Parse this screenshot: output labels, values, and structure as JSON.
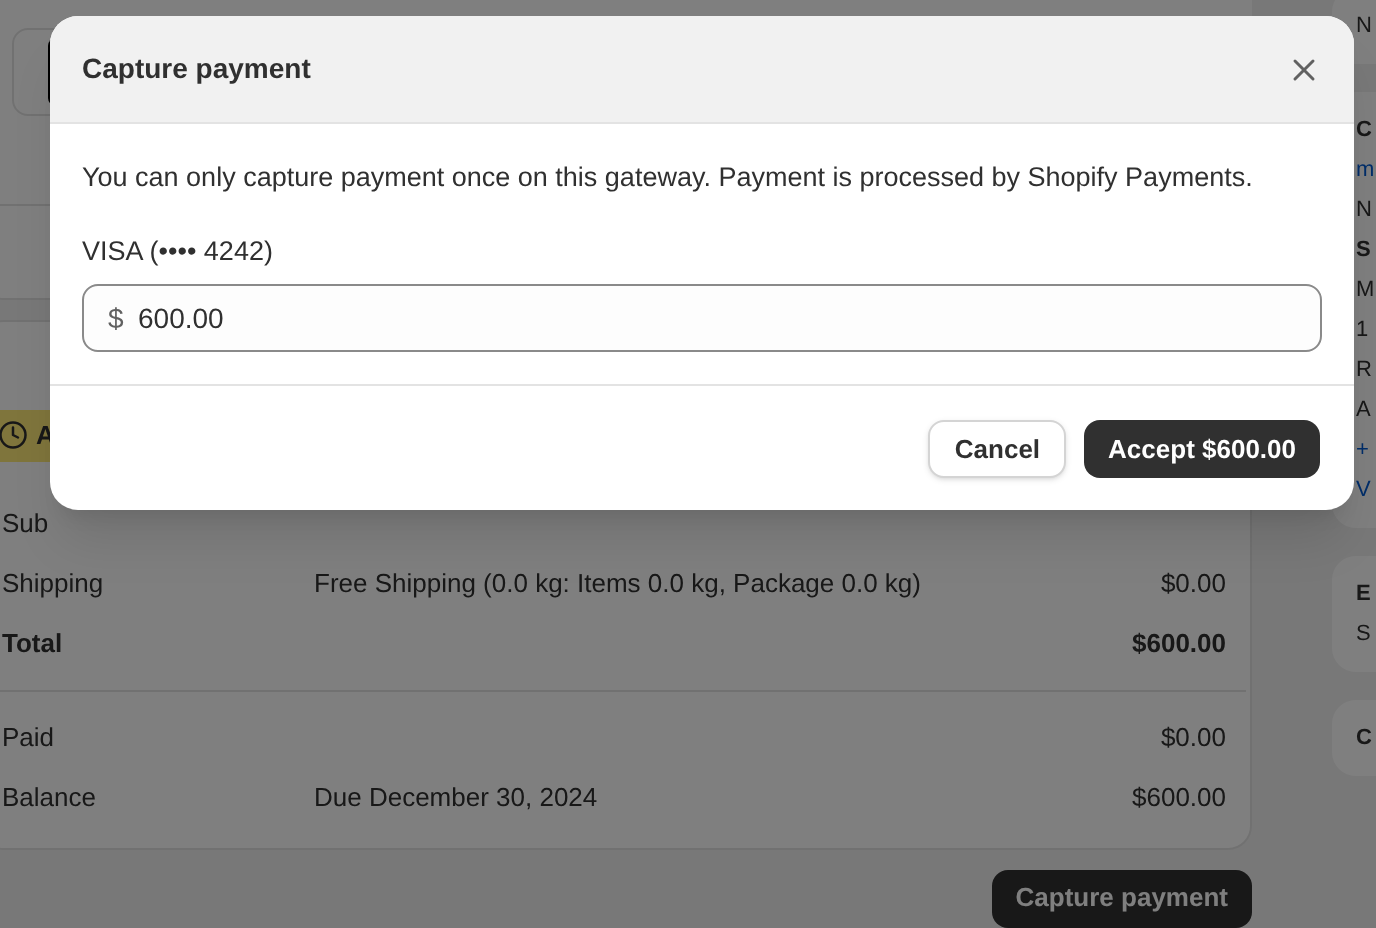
{
  "background": {
    "product_row": {
      "kind": "thumbnail"
    },
    "badge": {
      "text": "A"
    },
    "summary_rows": [
      {
        "label": "Sub",
        "detail": "",
        "amount": "",
        "bold": false
      },
      {
        "label": "Shipping",
        "detail": "Free Shipping (0.0 kg: Items 0.0 kg, Package 0.0 kg)",
        "amount": "$0.00",
        "bold": false
      },
      {
        "label": "Total",
        "detail": "",
        "amount": "$600.00",
        "bold": true
      }
    ],
    "payment_rows": [
      {
        "label": "Paid",
        "detail": "",
        "amount": "$0.00"
      },
      {
        "label": "Balance",
        "detail": "Due December 30, 2024",
        "amount": "$600.00"
      }
    ],
    "capture_button": "Capture payment",
    "side_cards": [
      {
        "lines": [
          {
            "text": "N",
            "kind": "plain"
          }
        ]
      },
      {
        "lines": [
          {
            "text": "C",
            "kind": "heading"
          },
          {
            "text": "m",
            "kind": "link"
          },
          {
            "text": "N",
            "kind": "plain"
          },
          {
            "text": "S",
            "kind": "heading"
          },
          {
            "text": "M",
            "kind": "plain"
          },
          {
            "text": "1",
            "kind": "plain"
          },
          {
            "text": "R",
            "kind": "plain"
          },
          {
            "text": "A",
            "kind": "plain"
          },
          {
            "text": "+",
            "kind": "link"
          },
          {
            "text": "V",
            "kind": "link"
          }
        ]
      },
      {
        "lines": [
          {
            "text": "E",
            "kind": "heading"
          },
          {
            "text": "S",
            "kind": "plain"
          }
        ]
      },
      {
        "lines": [
          {
            "text": "C",
            "kind": "heading"
          }
        ]
      }
    ]
  },
  "dialog": {
    "title": "Capture payment",
    "message": "You can only capture payment once on this gateway. Payment is processed by Shopify Payments.",
    "card_label": "VISA (•••• 4242)",
    "currency": "$",
    "amount": "600.00",
    "buttons": [
      {
        "label": "Cancel",
        "kind": "secondary"
      },
      {
        "label": "Accept $600.00",
        "kind": "primary"
      }
    ]
  }
}
